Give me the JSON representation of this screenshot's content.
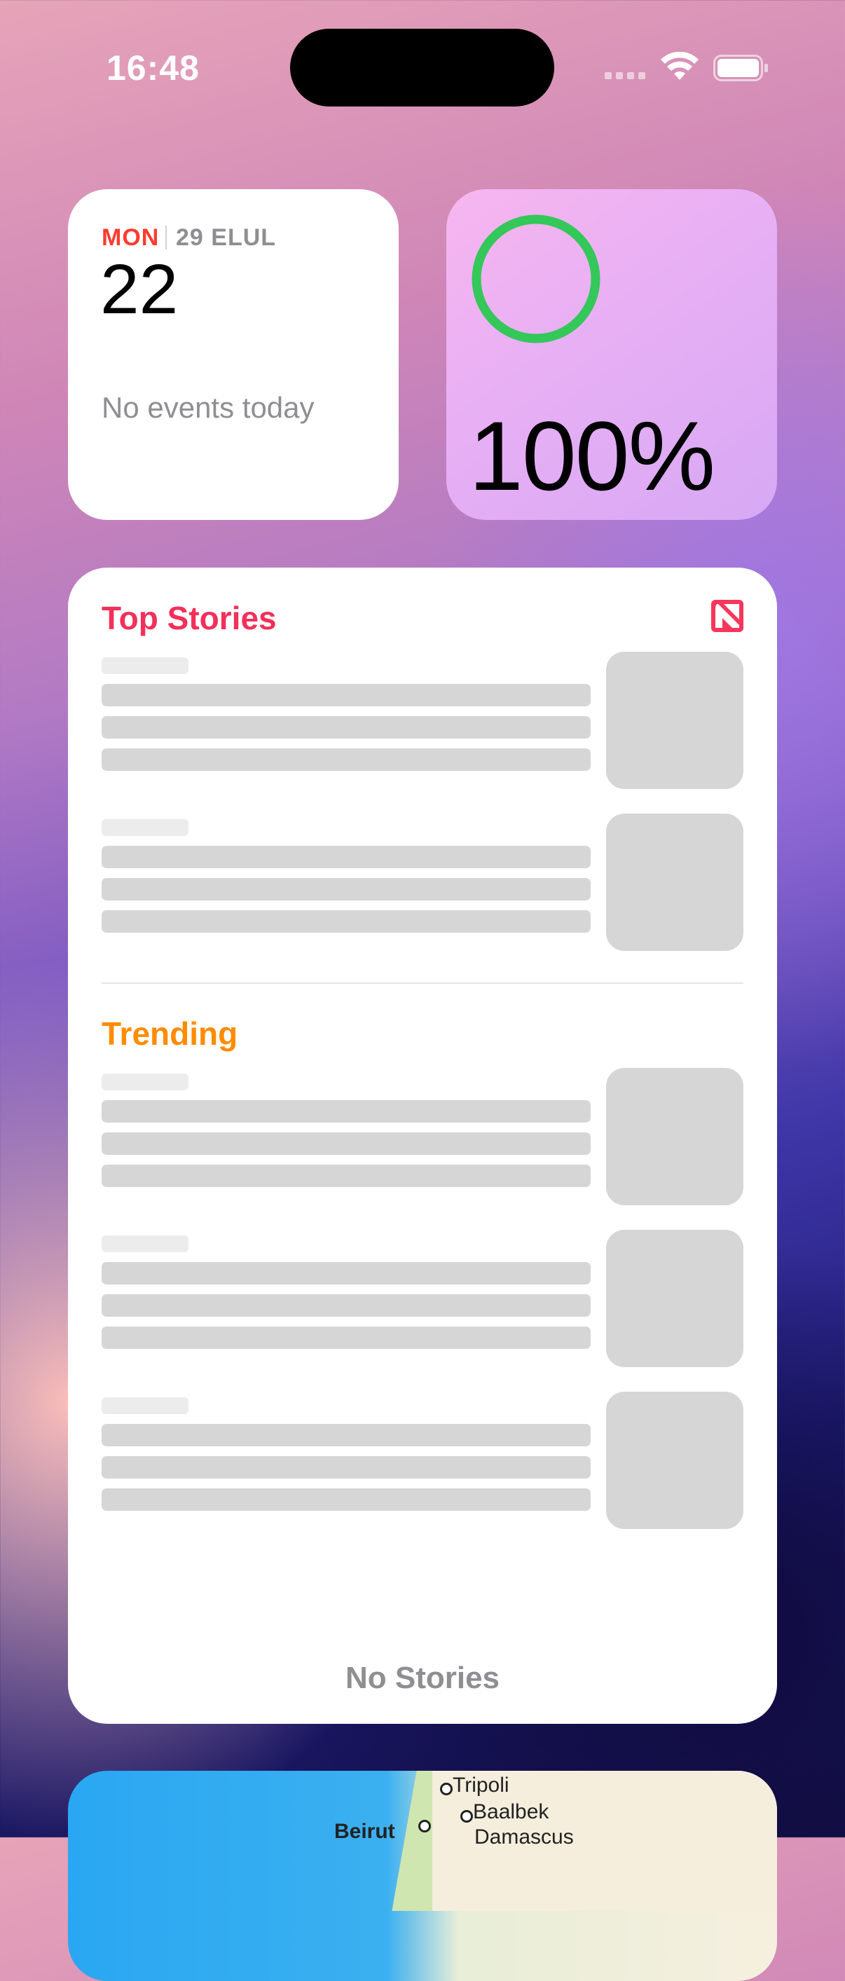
{
  "status_bar": {
    "time": "16:48"
  },
  "calendar_widget": {
    "weekday": "MON",
    "hebrew_date": "29 ELUL",
    "day_number": "22",
    "empty_message": "No events today"
  },
  "battery_widget": {
    "percent_label": "100%",
    "level": 1.0,
    "ring_color": "#34c759"
  },
  "news_widget": {
    "top_stories_title": "Top Stories",
    "trending_title": "Trending",
    "empty_message": "No Stories",
    "accent_top": "#f2305a",
    "accent_trending": "#ff8c00"
  },
  "map_widget": {
    "labels": [
      "Tripoli",
      "Baalbek",
      "Beirut",
      "Damascus"
    ]
  },
  "icons": [
    "wifi-icon",
    "battery-icon",
    "cellular-signal-icon",
    "apple-news-icon"
  ]
}
